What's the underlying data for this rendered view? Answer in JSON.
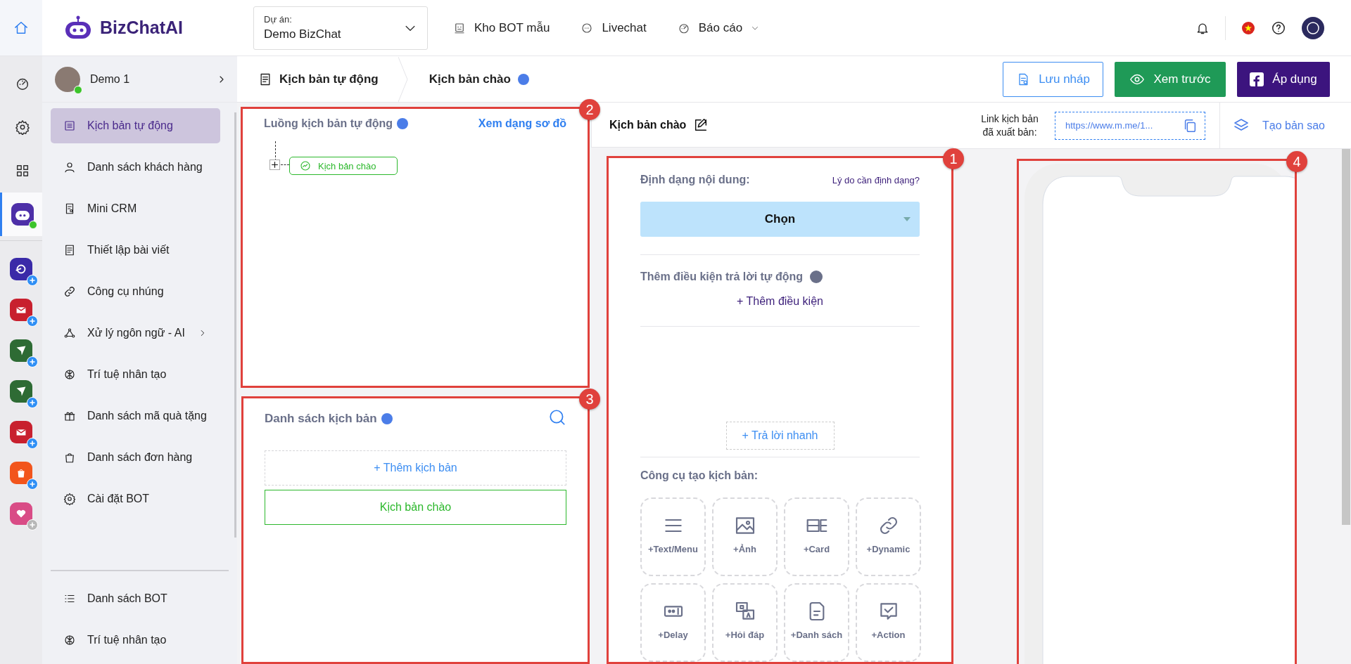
{
  "top_bar": {
    "brand": "BizChatAI",
    "project": {
      "label": "Dự án:",
      "value": "Demo BizChat"
    },
    "nav": [
      {
        "label": "Kho BOT mẫu",
        "kind": "robot",
        "dropdown": false
      },
      {
        "label": "Livechat",
        "kind": "chat",
        "dropdown": false
      },
      {
        "label": "Báo cáo",
        "kind": "gauge",
        "dropdown": true
      }
    ]
  },
  "rail": {
    "tools": [
      {
        "kind": "gauge",
        "selected": false
      },
      {
        "kind": "gear",
        "selected": false
      },
      {
        "kind": "grid",
        "selected": false
      },
      {
        "kind": "bot",
        "selected": true
      }
    ],
    "apps": [
      {
        "kind": "arrow",
        "color": "#3a2aa8",
        "added": true
      },
      {
        "kind": "mail",
        "color": "#c8202e",
        "added": true
      },
      {
        "kind": "plane",
        "color": "#2e6b34",
        "added": true
      },
      {
        "kind": "plane",
        "color": "#2e6b34",
        "added": true
      },
      {
        "kind": "mail",
        "color": "#c8202e",
        "added": true
      },
      {
        "kind": "bag",
        "color": "#f2551c",
        "added": true
      },
      {
        "kind": "heart",
        "color": "#d94c86",
        "added": false
      }
    ]
  },
  "sidebar": {
    "user": {
      "name": "Demo 1",
      "online": true
    },
    "items": [
      {
        "label": "Kịch bản tự động",
        "kind": "list",
        "selected": true,
        "submenu": false
      },
      {
        "label": "Danh sách khách hàng",
        "kind": "user",
        "selected": false,
        "submenu": false
      },
      {
        "label": "Mini CRM",
        "kind": "crm",
        "selected": false,
        "submenu": false
      },
      {
        "label": "Thiết lập bài viết",
        "kind": "doc",
        "selected": false,
        "submenu": false
      },
      {
        "label": "Công cụ nhúng",
        "kind": "link",
        "selected": false,
        "submenu": false
      },
      {
        "label": "Xử lý ngôn ngữ - AI",
        "kind": "nodes",
        "selected": false,
        "submenu": true
      },
      {
        "label": "Trí tuệ nhân tạo",
        "kind": "ai",
        "selected": false,
        "submenu": false
      },
      {
        "label": "Danh sách mã quà tặng",
        "kind": "gift",
        "selected": false,
        "submenu": false
      },
      {
        "label": "Danh sách đơn hàng",
        "kind": "bag",
        "selected": false,
        "submenu": false
      },
      {
        "label": "Cài đặt BOT",
        "kind": "gear",
        "selected": false,
        "submenu": false
      }
    ],
    "bottom_items": [
      {
        "label": "Danh sách BOT",
        "kind": "bullets",
        "selected": false,
        "submenu": false
      },
      {
        "label": "Trí tuệ nhân tạo",
        "kind": "ai",
        "selected": false,
        "submenu": false
      }
    ]
  },
  "header": {
    "breadcrumb": [
      {
        "label": "Kịch bản tự động",
        "kind": "section"
      },
      {
        "label": "Kịch bản chào",
        "kind": "page"
      }
    ],
    "buttons": [
      {
        "label": "Lưu nháp",
        "kind": "draft"
      },
      {
        "label": "Xem trước",
        "kind": "preview"
      },
      {
        "label": "Áp dụng",
        "kind": "apply"
      }
    ]
  },
  "flow_panel": {
    "annotation": "2",
    "title": "Luồng kịch bản tự động",
    "link": "Xem dạng sơ đồ",
    "nodes": [
      {
        "label": "Kịch bản chào"
      }
    ]
  },
  "script_list": {
    "annotation": "3",
    "title": "Danh sách kịch bản",
    "add_label": "+ Thêm kịch bản",
    "items": [
      {
        "label": "Kịch bản chào",
        "selected": true
      }
    ]
  },
  "editor": {
    "title": "Kịch bản chào",
    "annotation": "1",
    "format_label": "Định dạng nội dung:",
    "format_help": "Lý do cần định dạng?",
    "format_select": "Chọn",
    "condition_title": "Thêm điều kiện trả lời tự động",
    "add_condition": "+ Thêm điều kiện",
    "quick_reply": "+ Trả lời nhanh",
    "tools_title": "Công cụ tạo kịch bản:",
    "tools": [
      {
        "label": "+Text/Menu",
        "kind": "text"
      },
      {
        "label": "+Ảnh",
        "kind": "image"
      },
      {
        "label": "+Card",
        "kind": "card"
      },
      {
        "label": "+Dynamic",
        "kind": "dynamic"
      },
      {
        "label": "+Delay",
        "kind": "delay"
      },
      {
        "label": "+Hỏi đáp",
        "kind": "qa"
      },
      {
        "label": "+Danh sách",
        "kind": "list"
      },
      {
        "label": "+Action",
        "kind": "action"
      }
    ]
  },
  "publish": {
    "label": "Link kịch bản đã xuất bản:",
    "url": "https://www.m.me/1...",
    "duplicate": "Tạo bản sao"
  },
  "preview": {
    "annotation": "4"
  }
}
